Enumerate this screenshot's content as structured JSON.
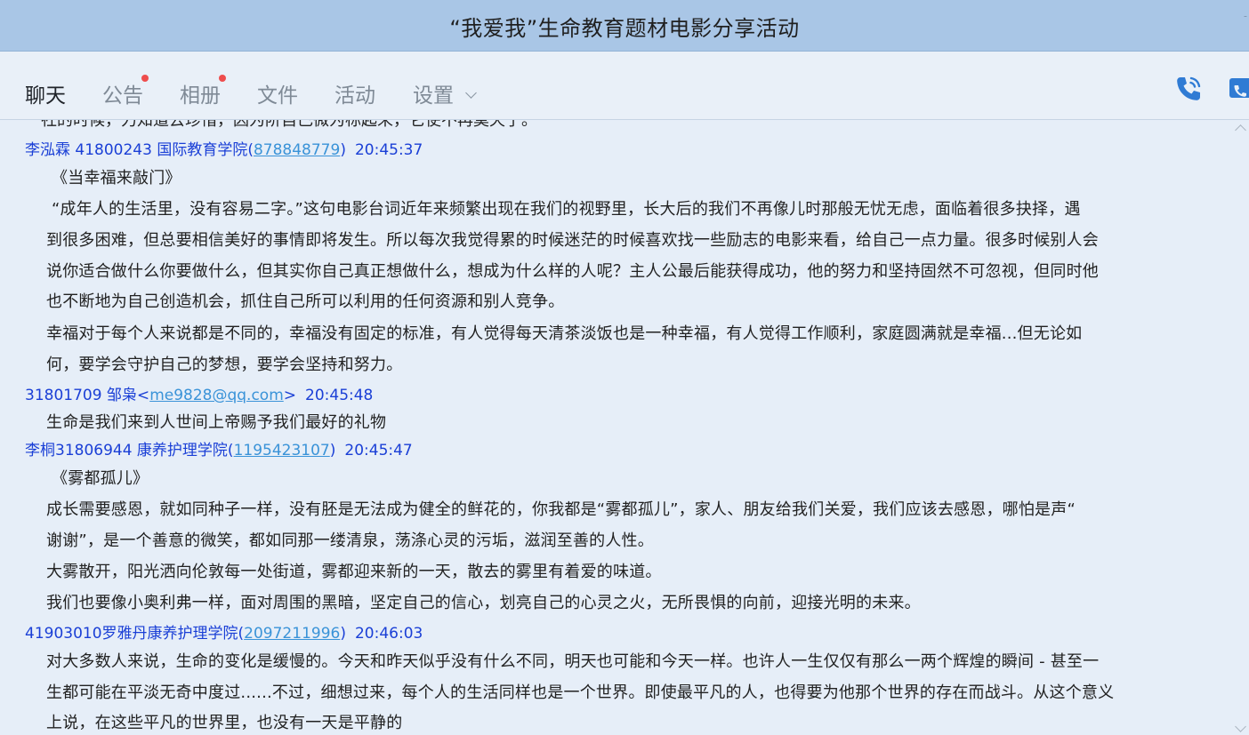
{
  "window": {
    "title": "“我爱我”生命教育题材电影分享活动",
    "corner_mark": "ᐨ"
  },
  "tabs": [
    {
      "label": "聊天",
      "active": true,
      "badge": false
    },
    {
      "label": "公告",
      "active": false,
      "badge": true
    },
    {
      "label": "相册",
      "active": false,
      "badge": true
    },
    {
      "label": "文件",
      "active": false,
      "badge": false
    },
    {
      "label": "活动",
      "active": false,
      "badge": false
    },
    {
      "label": "设置",
      "active": false,
      "badge": false
    }
  ],
  "colors": {
    "titlebar": "#a9c6e6",
    "sender": "#1a3fd6",
    "link": "#3a93d8",
    "badge": "#ee4d4d",
    "call_icon": "#2f7bd4"
  },
  "chat": {
    "cut_line": "一社的时候，力知道去珍惜，因为阶自己微为标起来，它使不再莫天了。",
    "messages": [
      {
        "name": "李泓霖 41800243 国际教育学院(",
        "contact": "878848779",
        "close": ")",
        "time": "20:45:37",
        "lines": [
          "《当幸福来敲门》",
          "“成年人的生活里，没有容易二字。”这句电影台词近年来频繁出现在我们的视野里，长大后的我们不再像儿时那般无忧无虑，面临着很多抉择，遇",
          "到很多困难，但总要相信美好的事情即将发生。所以每次我觉得累的时候迷茫的时候喜欢找一些励志的电影来看，给自己一点力量。很多时候别人会",
          "说你适合做什么你要做什么，但其实你自己真正想做什么，想成为什么样的人呢？主人公最后能获得成功，他的努力和坚持固然不可忽视，但同时他",
          "也不断地为自己创造机会，抓住自己所可以利用的任何资源和别人竞争。",
          "幸福对于每个人来说都是不同的，幸福没有固定的标准，有人觉得每天清茶淡饭也是一种幸福，有人觉得工作顺利，家庭圆满就是幸福...但无论如",
          "何，要学会守护自己的梦想，要学会坚持和努力。"
        ]
      },
      {
        "name": "31801709 邹枭<",
        "contact": "me9828@qq.com",
        "close": ">",
        "time": "20:45:48",
        "lines": [
          "生命是我们来到人世间上帝赐予我们最好的礼物"
        ]
      },
      {
        "name": "李桐31806944 康养护理学院(",
        "contact": "1195423107",
        "close": ")",
        "time": "20:45:47",
        "lines": [
          "《雾都孤儿》",
          "成长需要感恩，就如同种子一样，没有胚是无法成为健全的鲜花的，你我都是“雾都孤儿”，家人、朋友给我们关爱，我们应该去感恩，哪怕是声“",
          "谢谢”，是一个善意的微笑，都如同那一缕清泉，荡涤心灵的污垢，滋润至善的人性。",
          "大雾散开，阳光洒向伦敦每一处街道，雾都迎来新的一天，散去的雾里有着爱的味道。",
          "我们也要像小奥利弗一样，面对周围的黑暗，坚定自己的信心，划亮自己的心灵之火，无所畏惧的向前，迎接光明的未来。"
        ]
      },
      {
        "name": "41903010罗雅丹康养护理学院(",
        "contact": "2097211996",
        "close": ")",
        "time": "20:46:03",
        "lines": [
          "对大多数人来说，生命的变化是缓慢的。今天和昨天似乎没有什么不同，明天也可能和今天一样。也许人一生仅仅有那么一两个辉煌的瞬间 - 甚至一",
          "生都可能在平淡无奇中度过......不过，细想过来，每个人的生活同样也是一个世界。即使最平凡的人，也得要为他那个世界的存在而战斗。从这个意义",
          "上说，在这些平凡的世界里，也没有一天是平静的"
        ]
      }
    ]
  }
}
